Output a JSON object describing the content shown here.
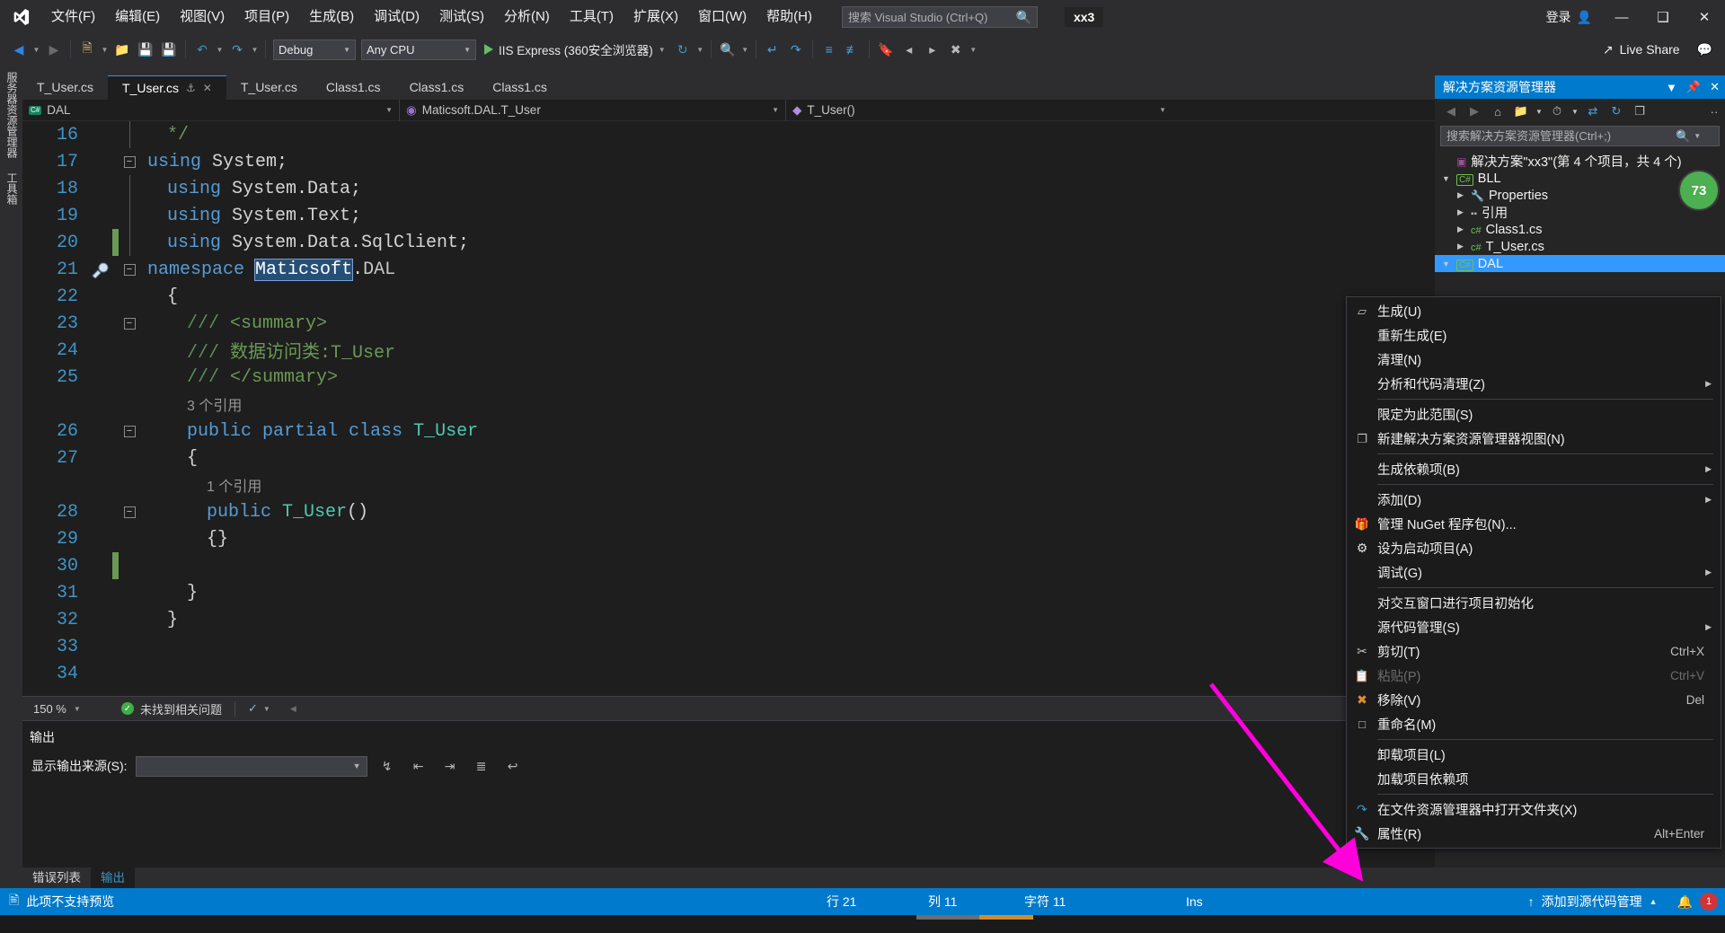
{
  "app": {
    "title": "Visual Studio",
    "solution_badge": "xx3",
    "signin_label": "登录",
    "live_share_label": "Live Share"
  },
  "menubar": {
    "items": [
      {
        "label": "文件(F)",
        "name": "menu-file"
      },
      {
        "label": "编辑(E)",
        "name": "menu-edit"
      },
      {
        "label": "视图(V)",
        "name": "menu-view"
      },
      {
        "label": "项目(P)",
        "name": "menu-project"
      },
      {
        "label": "生成(B)",
        "name": "menu-build"
      },
      {
        "label": "调试(D)",
        "name": "menu-debug"
      },
      {
        "label": "测试(S)",
        "name": "menu-test"
      },
      {
        "label": "分析(N)",
        "name": "menu-analyze"
      },
      {
        "label": "工具(T)",
        "name": "menu-tools"
      },
      {
        "label": "扩展(X)",
        "name": "menu-extensions"
      },
      {
        "label": "窗口(W)",
        "name": "menu-window"
      },
      {
        "label": "帮助(H)",
        "name": "menu-help"
      }
    ]
  },
  "search": {
    "placeholder": "搜索 Visual Studio (Ctrl+Q)",
    "value": ""
  },
  "toolbar": {
    "config": "Debug",
    "platform": "Any CPU",
    "run_target": "IIS Express (360安全浏览器)"
  },
  "vertical_tabs": [
    {
      "label": "服务器资源管理器"
    },
    {
      "label": "工具箱"
    }
  ],
  "editor_tabs": [
    {
      "label": "T_User.cs",
      "active": false
    },
    {
      "label": "T_User.cs",
      "active": true
    },
    {
      "label": "T_User.cs",
      "active": false
    },
    {
      "label": "Class1.cs",
      "active": false
    },
    {
      "label": "Class1.cs",
      "active": false
    },
    {
      "label": "Class1.cs",
      "active": false
    }
  ],
  "navbar": {
    "project": "DAL",
    "type": "Maticsoft.DAL.T_User",
    "member": "T_User()"
  },
  "code": {
    "lines": [
      {
        "num": "16",
        "fold": "",
        "change": "",
        "indent": 1,
        "segments": [
          {
            "t": "*/",
            "c": "cmt"
          }
        ],
        "vline": true
      },
      {
        "num": "17",
        "fold": "minus",
        "change": "",
        "indent": 0,
        "segments": [
          {
            "t": "using",
            "c": "kw"
          },
          {
            "t": " System;",
            "c": ""
          }
        ]
      },
      {
        "num": "18",
        "fold": "",
        "change": "",
        "indent": 1,
        "segments": [
          {
            "t": "using",
            "c": "kw"
          },
          {
            "t": " System.Data;",
            "c": ""
          }
        ],
        "vline": true
      },
      {
        "num": "19",
        "fold": "",
        "change": "",
        "indent": 1,
        "segments": [
          {
            "t": "using",
            "c": "kw"
          },
          {
            "t": " System.Text;",
            "c": ""
          }
        ],
        "vline": true
      },
      {
        "num": "20",
        "fold": "",
        "change": "green",
        "indent": 1,
        "segments": [
          {
            "t": "using",
            "c": "kw"
          },
          {
            "t": " System.Data.SqlClient;",
            "c": ""
          }
        ],
        "vline": true
      },
      {
        "num": "21",
        "fold": "minus",
        "change": "",
        "bulb": true,
        "indent": 0,
        "segments": [
          {
            "t": "namespace",
            "c": "kw"
          },
          {
            "t": " ",
            "c": ""
          },
          {
            "t": "Maticsoft",
            "c": "sel"
          },
          {
            "t": ".",
            "c": ""
          },
          {
            "t": "DAL",
            "c": "nsdim"
          }
        ]
      },
      {
        "num": "22",
        "fold": "",
        "change": "",
        "indent": 1,
        "segments": [
          {
            "t": "{",
            "c": ""
          }
        ]
      },
      {
        "num": "23",
        "fold": "minus",
        "change": "",
        "indent": 2,
        "segments": [
          {
            "t": "/// ",
            "c": "xdoc"
          },
          {
            "t": "<summary>",
            "c": "cmt"
          }
        ]
      },
      {
        "num": "24",
        "fold": "",
        "change": "",
        "indent": 2,
        "segments": [
          {
            "t": "/// ",
            "c": "xdoc"
          },
          {
            "t": "数据访问类:T_User",
            "c": "cmt"
          }
        ]
      },
      {
        "num": "25",
        "fold": "",
        "change": "",
        "indent": 2,
        "segments": [
          {
            "t": "/// ",
            "c": "xdoc"
          },
          {
            "t": "</summary>",
            "c": "cmt"
          }
        ]
      },
      {
        "num": "",
        "fold": "",
        "change": "",
        "indent": 2,
        "codelens": "3 个引用"
      },
      {
        "num": "26",
        "fold": "minus",
        "change": "",
        "indent": 2,
        "segments": [
          {
            "t": "public partial class",
            "c": "kw"
          },
          {
            "t": " ",
            "c": ""
          },
          {
            "t": "T_User",
            "c": "cls"
          }
        ]
      },
      {
        "num": "27",
        "fold": "",
        "change": "",
        "indent": 2,
        "segments": [
          {
            "t": "{",
            "c": ""
          }
        ]
      },
      {
        "num": "",
        "fold": "",
        "change": "",
        "indent": 3,
        "codelens": "1 个引用"
      },
      {
        "num": "28",
        "fold": "minus",
        "change": "",
        "indent": 3,
        "segments": [
          {
            "t": "public",
            "c": "kw"
          },
          {
            "t": " ",
            "c": ""
          },
          {
            "t": "T_User",
            "c": "cls"
          },
          {
            "t": "()",
            "c": ""
          }
        ]
      },
      {
        "num": "29",
        "fold": "",
        "change": "",
        "indent": 3,
        "segments": [
          {
            "t": "{}",
            "c": ""
          }
        ]
      },
      {
        "num": "30",
        "fold": "",
        "change": "green",
        "indent": 3,
        "segments": []
      },
      {
        "num": "31",
        "fold": "",
        "change": "",
        "indent": 2,
        "segments": [
          {
            "t": "}",
            "c": ""
          }
        ]
      },
      {
        "num": "32",
        "fold": "",
        "change": "",
        "indent": 1,
        "segments": [
          {
            "t": "}",
            "c": ""
          }
        ]
      },
      {
        "num": "33",
        "fold": "",
        "change": "",
        "indent": 0,
        "segments": []
      },
      {
        "num": "34",
        "fold": "",
        "change": "",
        "indent": 0,
        "segments": []
      }
    ]
  },
  "editor_status": {
    "zoom": "150 %",
    "issues": "未找到相关问题"
  },
  "output_pane": {
    "title": "输出",
    "source_label": "显示输出来源(S):",
    "source_value": ""
  },
  "dock_tabs": [
    {
      "label": "错误列表",
      "active": false
    },
    {
      "label": "输出",
      "active": true
    }
  ],
  "solution_explorer": {
    "title": "解决方案资源管理器",
    "search_placeholder": "搜索解决方案资源管理器(Ctrl+;)",
    "coverage_badge": "73",
    "tree": [
      {
        "label": "解决方案\"xx3\"(第 4 个项目，共 4 个)",
        "level": 0,
        "icon": "solution",
        "arrow": "",
        "selected": false
      },
      {
        "label": "BLL",
        "level": 0,
        "icon": "csproj",
        "arrow": "open",
        "selected": false
      },
      {
        "label": "Properties",
        "level": 1,
        "icon": "wrench",
        "arrow": "closed",
        "selected": false
      },
      {
        "label": "引用",
        "level": 1,
        "icon": "refs",
        "arrow": "closed",
        "selected": false
      },
      {
        "label": "Class1.cs",
        "level": 1,
        "icon": "csfile",
        "arrow": "closed",
        "selected": false
      },
      {
        "label": "T_User.cs",
        "level": 1,
        "icon": "csfile",
        "arrow": "closed",
        "selected": false
      },
      {
        "label": "DAL",
        "level": 0,
        "icon": "csproj",
        "arrow": "open",
        "selected": true
      }
    ]
  },
  "context_menu": {
    "items": [
      {
        "label": "生成(U)",
        "icon": "build-icon",
        "key": "",
        "submenu": false,
        "disabled": false,
        "sep_after": false
      },
      {
        "label": "重新生成(E)",
        "icon": "",
        "key": "",
        "submenu": false,
        "disabled": false,
        "sep_after": false
      },
      {
        "label": "清理(N)",
        "icon": "",
        "key": "",
        "submenu": false,
        "disabled": false,
        "sep_after": false
      },
      {
        "label": "分析和代码清理(Z)",
        "icon": "",
        "key": "",
        "submenu": true,
        "disabled": false,
        "sep_after": true
      },
      {
        "label": "限定为此范围(S)",
        "icon": "",
        "key": "",
        "submenu": false,
        "disabled": false,
        "sep_after": false
      },
      {
        "label": "新建解决方案资源管理器视图(N)",
        "icon": "newview-icon",
        "key": "",
        "submenu": false,
        "disabled": false,
        "sep_after": true
      },
      {
        "label": "生成依赖项(B)",
        "icon": "",
        "key": "",
        "submenu": true,
        "disabled": false,
        "sep_after": true
      },
      {
        "label": "添加(D)",
        "icon": "",
        "key": "",
        "submenu": true,
        "disabled": false,
        "sep_after": false
      },
      {
        "label": "管理 NuGet 程序包(N)...",
        "icon": "nuget-icon",
        "key": "",
        "submenu": false,
        "disabled": false,
        "sep_after": false
      },
      {
        "label": "设为启动项目(A)",
        "icon": "gear-icon",
        "key": "",
        "submenu": false,
        "disabled": false,
        "sep_after": false
      },
      {
        "label": "调试(G)",
        "icon": "",
        "key": "",
        "submenu": true,
        "disabled": false,
        "sep_after": true
      },
      {
        "label": "对交互窗口进行项目初始化",
        "icon": "",
        "key": "",
        "submenu": false,
        "disabled": false,
        "sep_after": false
      },
      {
        "label": "源代码管理(S)",
        "icon": "",
        "key": "",
        "submenu": true,
        "disabled": false,
        "sep_after": false
      },
      {
        "label": "剪切(T)",
        "icon": "scissors-icon",
        "key": "Ctrl+X",
        "submenu": false,
        "disabled": false,
        "sep_after": false
      },
      {
        "label": "粘贴(P)",
        "icon": "clipboard-icon",
        "key": "Ctrl+V",
        "submenu": false,
        "disabled": true,
        "sep_after": false
      },
      {
        "label": "移除(V)",
        "icon": "x-icon",
        "key": "Del",
        "submenu": false,
        "disabled": false,
        "sep_after": false
      },
      {
        "label": "重命名(M)",
        "icon": "rename-icon",
        "key": "",
        "submenu": false,
        "disabled": false,
        "sep_after": true
      },
      {
        "label": "卸载项目(L)",
        "icon": "",
        "key": "",
        "submenu": false,
        "disabled": false,
        "sep_after": false
      },
      {
        "label": "加载项目依赖项",
        "icon": "",
        "key": "",
        "submenu": false,
        "disabled": false,
        "sep_after": true
      },
      {
        "label": "在文件资源管理器中打开文件夹(X)",
        "icon": "folder-open-icon",
        "key": "",
        "submenu": false,
        "disabled": false,
        "sep_after": false
      },
      {
        "label": "属性(R)",
        "icon": "wrench-icon",
        "key": "Alt+Enter",
        "submenu": false,
        "disabled": false,
        "sep_after": false
      }
    ]
  },
  "statusbar": {
    "message": "此项不支持预览",
    "line_label": "行 21",
    "col_label": "列 11",
    "char_label": "字符 11",
    "ins_label": "Ins",
    "source_control": "添加到源代码管理",
    "notification_count": "1"
  }
}
